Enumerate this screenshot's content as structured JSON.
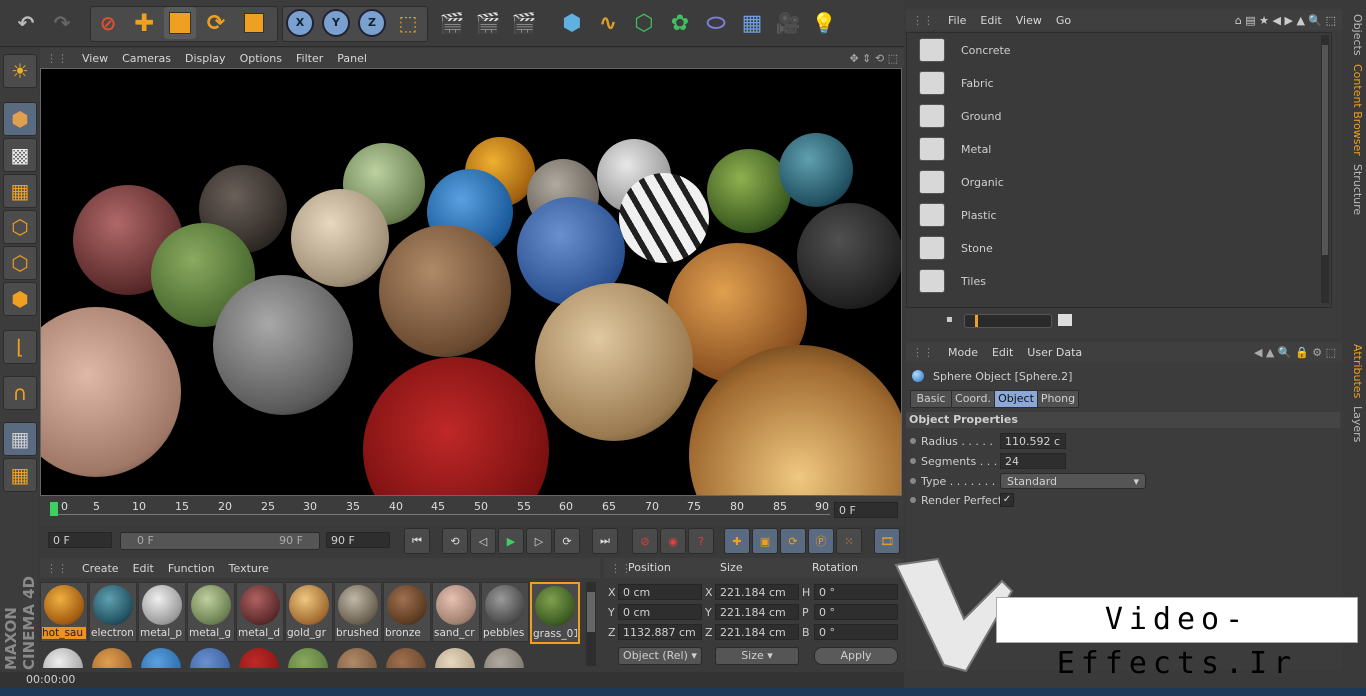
{
  "viewport_menu": [
    "View",
    "Cameras",
    "Display",
    "Options",
    "Filter",
    "Panel"
  ],
  "timeline": {
    "ticks": [
      "0",
      "5",
      "10",
      "15",
      "20",
      "25",
      "30",
      "35",
      "40",
      "45",
      "50",
      "55",
      "60",
      "65",
      "70",
      "75",
      "80",
      "85",
      "90"
    ],
    "current_frame": "0 F"
  },
  "transport": {
    "start": "0 F",
    "range_start": "0 F",
    "range_end": "90 F",
    "end": "90 F"
  },
  "material_menu": [
    "Create",
    "Edit",
    "Function",
    "Texture"
  ],
  "materials": [
    "hot_sau",
    "electron",
    "metal_p",
    "metal_g",
    "metal_d",
    "gold_gr",
    "brushed",
    "bronze",
    "sand_cr",
    "pebbles",
    "grass_01"
  ],
  "coords": {
    "headers": [
      "Position",
      "Size",
      "Rotation"
    ],
    "rows": [
      {
        "axis": "X",
        "pos": "0 cm",
        "saxis": "X",
        "size": "221.184 cm",
        "raxis": "H",
        "rot": "0 °"
      },
      {
        "axis": "Y",
        "pos": "0 cm",
        "saxis": "Y",
        "size": "221.184 cm",
        "raxis": "P",
        "rot": "0 °"
      },
      {
        "axis": "Z",
        "pos": "1132.887 cm",
        "saxis": "Z",
        "size": "221.184 cm",
        "raxis": "B",
        "rot": "0 °"
      }
    ],
    "mode": "Object (Rel)",
    "size_mode": "Size",
    "apply": "Apply"
  },
  "content_menu": [
    "File",
    "Edit",
    "View",
    "Go"
  ],
  "folders": [
    "Concrete",
    "Fabric",
    "Ground",
    "Metal",
    "Organic",
    "Plastic",
    "Stone",
    "Tiles"
  ],
  "attr_menu": [
    "Mode",
    "Edit",
    "User Data"
  ],
  "attr": {
    "object_title": "Sphere Object [Sphere.2]",
    "tabs": [
      "Basic",
      "Coord.",
      "Object",
      "Phong"
    ],
    "section": "Object Properties",
    "radius_label": "Radius . . . . .",
    "radius": "110.592 c",
    "segments_label": "Segments . . . .",
    "segments": "24",
    "type_label": "Type . . . . . . . .",
    "type": "Standard",
    "render_label": "Render Perfect",
    "render_check": "✓"
  },
  "side_tabs": [
    "Objects",
    "Content Browser",
    "Structure",
    "Attributes",
    "Layers"
  ],
  "status_time": "00:00:00",
  "logo_text": "Video-Effects.Ir",
  "brand": "MAXON CINEMA 4D"
}
